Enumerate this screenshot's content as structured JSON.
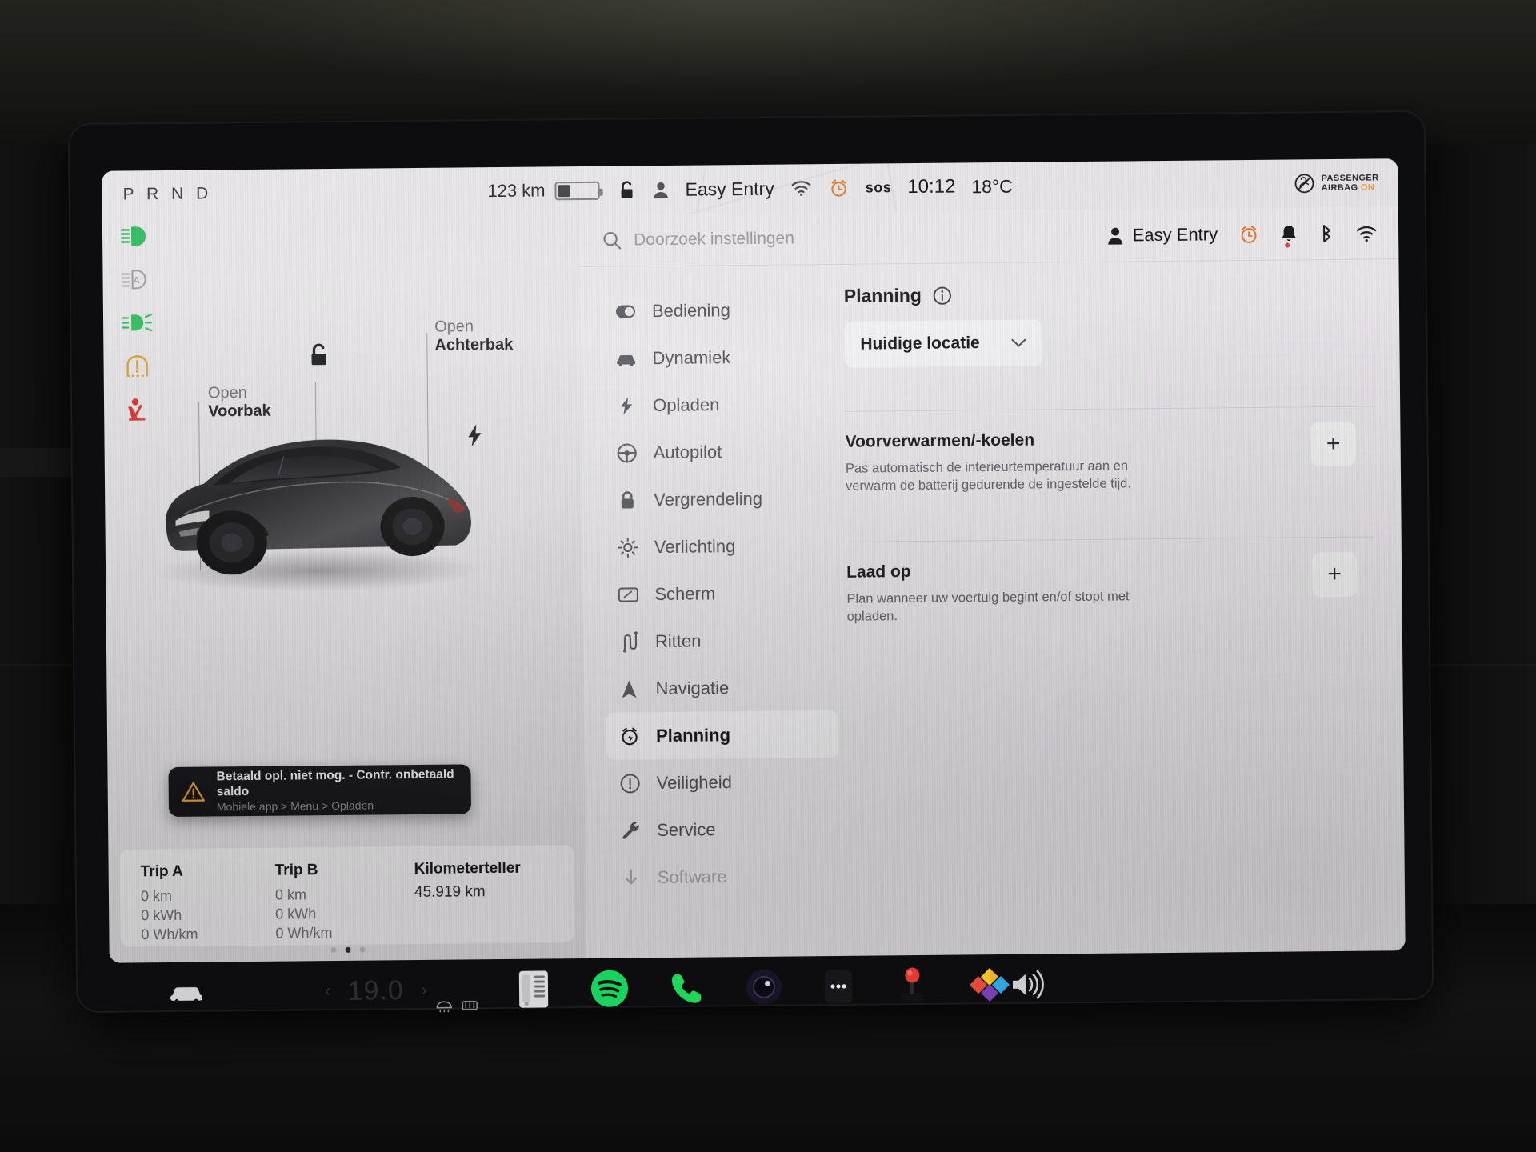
{
  "status_bar": {
    "gear_indicator": "P R N D",
    "range_value": "123 km",
    "battery_percent": 28,
    "lock_icon": "unlock-icon",
    "profile_name": "Easy Entry",
    "wifi_icon": "wifi-icon",
    "alarm_icon": "alarm-clock-icon",
    "sos_label": "sos",
    "time": "10:12",
    "outside_temp": "18°C",
    "airbag_line1": "PASSENGER",
    "airbag_line2": "AIRBAG",
    "airbag_state": "ON",
    "airbag_state_color": "#e8a13c"
  },
  "telltales": [
    {
      "name": "low-beam-icon",
      "color": "#2fbf5e",
      "label": "Dimlicht"
    },
    {
      "name": "auto-high-beam-icon",
      "color": "#9b9ba0",
      "label": "Automatisch grootlicht"
    },
    {
      "name": "fog-light-icon",
      "color": "#2fbf5e",
      "label": "Mistlicht"
    },
    {
      "name": "tire-pressure-warning-icon",
      "color": "#d9a22a",
      "label": "Bandenspanning"
    },
    {
      "name": "seatbelt-warning-icon",
      "color": "#d5342c",
      "label": "Gordel"
    }
  ],
  "car_view": {
    "front_trunk_lead": "Open",
    "front_trunk_label": "Voorbak",
    "rear_trunk_lead": "Open",
    "rear_trunk_label": "Achterbak",
    "lock_state_icon": "unlock-icon",
    "charge_port_icon": "charge-bolt-icon"
  },
  "toast": {
    "icon": "warning-triangle-icon",
    "title": "Betaald opl. niet mog. - Contr. onbetaald saldo",
    "subtitle": "Mobiele app > Menu > Opladen",
    "accent_color": "#e8a13c"
  },
  "trips": {
    "trip_a": {
      "title": "Trip A",
      "distance": "0 km",
      "energy": "0 kWh",
      "efficiency": "0 Wh/km"
    },
    "trip_b": {
      "title": "Trip B",
      "distance": "0 km",
      "energy": "0 kWh",
      "efficiency": "0 Wh/km"
    },
    "odometer": {
      "title": "Kilometerteller",
      "value": "45.919 km"
    }
  },
  "page_dots": {
    "count": 3,
    "active_index": 1
  },
  "settings": {
    "search_placeholder": "Doorzoek instellingen",
    "search_value": "",
    "profile_name": "Easy Entry",
    "status_icons": [
      "alarm-clock-icon",
      "bell-icon",
      "bluetooth-icon",
      "wifi-icon"
    ],
    "menu": [
      {
        "label": "Bediening",
        "icon": "toggle-icon",
        "active": false,
        "dim": false
      },
      {
        "label": "Dynamiek",
        "icon": "car-front-icon",
        "active": false,
        "dim": false
      },
      {
        "label": "Opladen",
        "icon": "bolt-icon",
        "active": false,
        "dim": false
      },
      {
        "label": "Autopilot",
        "icon": "steering-wheel-icon",
        "active": false,
        "dim": false
      },
      {
        "label": "Vergrendeling",
        "icon": "lock-icon",
        "active": false,
        "dim": false
      },
      {
        "label": "Verlichting",
        "icon": "sun-icon",
        "active": false,
        "dim": false
      },
      {
        "label": "Scherm",
        "icon": "display-icon",
        "active": false,
        "dim": false
      },
      {
        "label": "Ritten",
        "icon": "route-icon",
        "active": false,
        "dim": false
      },
      {
        "label": "Navigatie",
        "icon": "navigation-arrow-icon",
        "active": false,
        "dim": false
      },
      {
        "label": "Planning",
        "icon": "schedule-clock-icon",
        "active": true,
        "dim": false
      },
      {
        "label": "Veiligheid",
        "icon": "info-circle-icon",
        "active": false,
        "dim": false
      },
      {
        "label": "Service",
        "icon": "wrench-icon",
        "active": false,
        "dim": false
      },
      {
        "label": "Software",
        "icon": "download-arrow-icon",
        "active": false,
        "dim": true
      }
    ],
    "detail": {
      "title": "Planning",
      "info_icon": "info-circle-icon",
      "location_dropdown": {
        "value": "Huidige locatie",
        "chevron": "chevron-down-icon"
      },
      "sections": [
        {
          "title": "Voorverwarmen/-koelen",
          "description": "Pas automatisch de interieurtemperatuur aan en verwarm de batterij gedurende de ingestelde tijd.",
          "add_label": "+"
        },
        {
          "title": "Laad op",
          "description": "Plan wanneer uw voertuig begint en/of stopt met opladen.",
          "add_label": "+"
        }
      ]
    }
  },
  "dock": {
    "car_icon": "car-icon",
    "temp_left_arrow": "‹",
    "temp_value": "19.0",
    "temp_right_arrow": "›",
    "defrost_icons": [
      "front-defrost-icon",
      "rear-defrost-icon"
    ],
    "apps": [
      {
        "name": "climate-vent-icon",
        "label": "Klimaat"
      },
      {
        "name": "spotify-icon",
        "label": "Spotify"
      },
      {
        "name": "phone-icon",
        "label": "Telefoon"
      },
      {
        "name": "camera-icon",
        "label": "Camera"
      },
      {
        "name": "more-dots-icon",
        "label": "Meer"
      },
      {
        "name": "arcade-joystick-icon",
        "label": "Arcade"
      },
      {
        "name": "toybox-icon",
        "label": "Toybox"
      }
    ],
    "volume_icon": "volume-icon"
  }
}
